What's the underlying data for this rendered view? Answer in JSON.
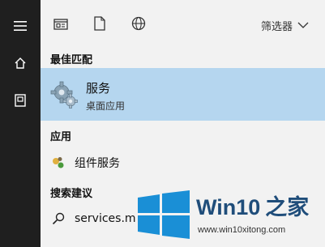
{
  "filter": {
    "label": "筛选器"
  },
  "sections": {
    "best_match": "最佳匹配",
    "apps": "应用",
    "suggestions": "搜索建议"
  },
  "best_match": {
    "title": "服务",
    "subtitle": "桌面应用"
  },
  "apps": [
    {
      "label": "组件服务"
    }
  ],
  "suggestions": [
    {
      "label": "services.m"
    }
  ],
  "watermark": {
    "brand_prefix": "Win10",
    "brand_suffix": "之家",
    "url": "www.win10xitong.com"
  },
  "colors": {
    "rail": "#1f1f1f",
    "panel": "#f2f2f2",
    "selection": "#b5d6ef",
    "logo_blue": "#1a8fd6",
    "brand": "#1f4d7a"
  },
  "icons": [
    "hamburger-icon",
    "home-icon",
    "documents-icon",
    "apps-icon",
    "document-icon",
    "web-icon",
    "chevron-down-icon",
    "gear-icon",
    "component-services-icon",
    "search-icon",
    "windows-logo"
  ]
}
